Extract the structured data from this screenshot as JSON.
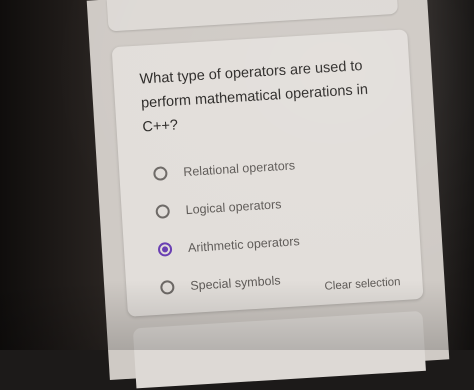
{
  "question": {
    "text": "What type of operators are used to perform mathematical operations in C++?"
  },
  "options": [
    {
      "label": "Relational operators",
      "selected": false
    },
    {
      "label": "Logical operators",
      "selected": false
    },
    {
      "label": "Arithmetic operators",
      "selected": true
    },
    {
      "label": "Special symbols",
      "selected": false
    }
  ],
  "clear_selection_label": "Clear selection",
  "colors": {
    "accent": "#6a3fb3",
    "card": "#e2deda"
  }
}
